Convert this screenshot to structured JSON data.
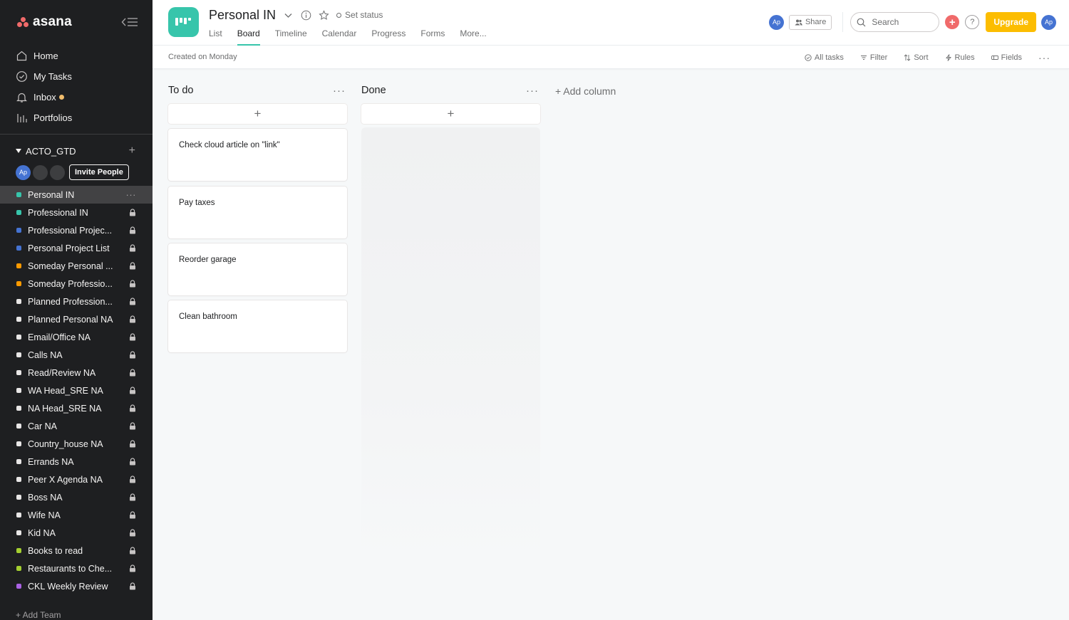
{
  "app": {
    "logo_text": "asana"
  },
  "sidebar": {
    "nav": [
      {
        "label": "Home",
        "icon": "home-icon"
      },
      {
        "label": "My Tasks",
        "icon": "check-circle-icon"
      },
      {
        "label": "Inbox",
        "icon": "bell-icon"
      },
      {
        "label": "Portfolios",
        "icon": "bar-chart-icon"
      }
    ],
    "team": {
      "name": "ACTO_GTD",
      "member_initials": "Ap",
      "invite_label": "Invite People"
    },
    "projects": [
      {
        "label": "Personal IN",
        "color": "#37c5ab",
        "active": true
      },
      {
        "label": "Professional IN",
        "color": "#37c5ab"
      },
      {
        "label": "Professional Projec...",
        "color": "#4573d2"
      },
      {
        "label": "Personal Project List",
        "color": "#4573d2"
      },
      {
        "label": "Someday Personal ...",
        "color": "#fd9a00"
      },
      {
        "label": "Someday Professio...",
        "color": "#fd9a00"
      },
      {
        "label": "Planned Profession...",
        "color": "#e8e6e6"
      },
      {
        "label": "Planned Personal NA",
        "color": "#e8e6e6"
      },
      {
        "label": "Email/Office NA",
        "color": "#e8e6e6"
      },
      {
        "label": "Calls NA",
        "color": "#e8e6e6"
      },
      {
        "label": "Read/Review NA",
        "color": "#e8e6e6"
      },
      {
        "label": "WA Head_SRE NA",
        "color": "#e8e6e6"
      },
      {
        "label": "NA Head_SRE NA",
        "color": "#e8e6e6"
      },
      {
        "label": "Car NA",
        "color": "#e8e6e6"
      },
      {
        "label": "Country_house NA",
        "color": "#e8e6e6"
      },
      {
        "label": "Errands NA",
        "color": "#e8e6e6"
      },
      {
        "label": "Peer X Agenda NA",
        "color": "#e8e6e6"
      },
      {
        "label": "Boss NA",
        "color": "#e8e6e6"
      },
      {
        "label": "Wife NA",
        "color": "#e8e6e6"
      },
      {
        "label": "Kid NA",
        "color": "#e8e6e6"
      },
      {
        "label": "Books to read",
        "color": "#a4cf30"
      },
      {
        "label": "Restaurants to Che...",
        "color": "#a4cf30"
      },
      {
        "label": "CKL Weekly Review",
        "color": "#aa62e3"
      }
    ],
    "add_team_label": "+ Add Team"
  },
  "header": {
    "title": "Personal IN",
    "set_status_label": "Set status",
    "tabs": [
      "List",
      "Board",
      "Timeline",
      "Calendar",
      "Progress",
      "Forms",
      "More..."
    ],
    "active_tab": "Board",
    "avatar_initials": "Ap",
    "share_label": "Share",
    "search_placeholder": "Search",
    "help_label": "?",
    "upgrade_label": "Upgrade",
    "accent_color": "#37c5ab",
    "upgrade_color": "#fcbd01"
  },
  "toolbar": {
    "created_label": "Created on Monday",
    "all_tasks_label": "All tasks",
    "filter_label": "Filter",
    "sort_label": "Sort",
    "rules_label": "Rules",
    "fields_label": "Fields"
  },
  "board": {
    "columns": [
      {
        "title": "To do",
        "cards": [
          "Check cloud article on \"link\"",
          "Pay taxes",
          "Reorder garage",
          "Clean bathroom"
        ]
      },
      {
        "title": "Done",
        "cards": []
      }
    ],
    "add_column_label": "+ Add column"
  }
}
